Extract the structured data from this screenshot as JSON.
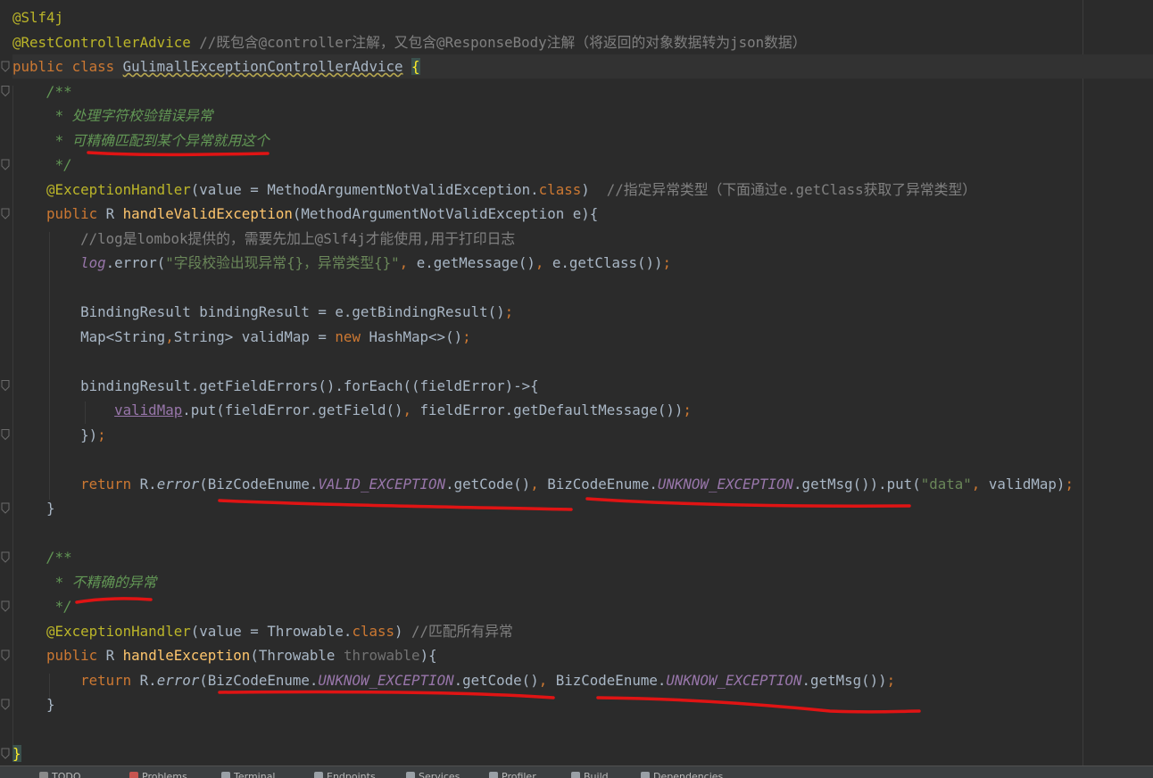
{
  "editor": {
    "lines": [
      [
        {
          "c": "ann",
          "t": "@Slf4j"
        }
      ],
      [
        {
          "c": "ann",
          "t": "@RestControllerAdvice"
        },
        {
          "c": "",
          "t": " "
        },
        {
          "c": "cmt",
          "t": "//既包含@controller注解，又包含@ResponseBody注解（将返回的对象数据转为json数据）"
        }
      ],
      [
        {
          "c": "kw",
          "t": "public class "
        },
        {
          "c": "ul-yellow",
          "t": "GulimallExceptionControllerAdvice"
        },
        {
          "c": "",
          "t": " "
        },
        {
          "c": "brace-match",
          "t": "{"
        }
      ],
      [
        {
          "c": "",
          "t": "    "
        },
        {
          "c": "doc",
          "t": "/**"
        }
      ],
      [
        {
          "c": "",
          "t": "     "
        },
        {
          "c": "doc",
          "t": "* 处理字符校验错误异常"
        }
      ],
      [
        {
          "c": "",
          "t": "     "
        },
        {
          "c": "doc",
          "t": "* 可精确匹配到某个异常就用这个"
        }
      ],
      [
        {
          "c": "",
          "t": "     "
        },
        {
          "c": "doc",
          "t": "*/"
        }
      ],
      [
        {
          "c": "",
          "t": "    "
        },
        {
          "c": "ann",
          "t": "@ExceptionHandler"
        },
        {
          "c": "",
          "t": "(value = MethodArgumentNotValidException."
        },
        {
          "c": "kw",
          "t": "class"
        },
        {
          "c": "",
          "t": ")  "
        },
        {
          "c": "cmt",
          "t": "//指定异常类型（下面通过e.getClass获取了异常类型）"
        }
      ],
      [
        {
          "c": "",
          "t": "    "
        },
        {
          "c": "kw",
          "t": "public "
        },
        {
          "c": "",
          "t": "R "
        },
        {
          "c": "meth",
          "t": "handleValidException"
        },
        {
          "c": "",
          "t": "(MethodArgumentNotValidException e){"
        }
      ],
      [
        {
          "c": "",
          "t": "        "
        },
        {
          "c": "cmt",
          "t": "//log是lombok提供的，需要先加上@Slf4j才能使用,用于打印日志"
        }
      ],
      [
        {
          "c": "",
          "t": "        "
        },
        {
          "c": "stat",
          "t": "log"
        },
        {
          "c": "",
          "t": ".error("
        },
        {
          "c": "str",
          "t": "\"字段校验出现异常{}，异常类型{}\""
        },
        {
          "c": "kw",
          "t": ", "
        },
        {
          "c": "",
          "t": "e.getMessage()"
        },
        {
          "c": "kw",
          "t": ", "
        },
        {
          "c": "",
          "t": "e.getClass())"
        },
        {
          "c": "kw",
          "t": ";"
        }
      ],
      [],
      [
        {
          "c": "",
          "t": "        BindingResult bindingResult = e.getBindingResult()"
        },
        {
          "c": "kw",
          "t": ";"
        }
      ],
      [
        {
          "c": "",
          "t": "        Map<String"
        },
        {
          "c": "kw",
          "t": ","
        },
        {
          "c": "",
          "t": "String> validMap = "
        },
        {
          "c": "kw",
          "t": "new "
        },
        {
          "c": "",
          "t": "HashMap<>()"
        },
        {
          "c": "kw",
          "t": ";"
        }
      ],
      [],
      [
        {
          "c": "",
          "t": "        bindingResult.getFieldErrors().forEach((fieldError)->{"
        }
      ],
      [
        {
          "c": "",
          "t": "            "
        },
        {
          "c": "inst ul-purple",
          "t": "validMap"
        },
        {
          "c": "",
          "t": ".put(fieldError.getField()"
        },
        {
          "c": "kw",
          "t": ", "
        },
        {
          "c": "",
          "t": "fieldError.getDefaultMessage())"
        },
        {
          "c": "kw",
          "t": ";"
        }
      ],
      [
        {
          "c": "",
          "t": "        })"
        },
        {
          "c": "kw",
          "t": ";"
        }
      ],
      [],
      [
        {
          "c": "",
          "t": "        "
        },
        {
          "c": "kw",
          "t": "return "
        },
        {
          "c": "",
          "t": "R."
        },
        {
          "c": "italic",
          "t": "error"
        },
        {
          "c": "",
          "t": "(BizCodeEnume."
        },
        {
          "c": "stat",
          "t": "VALID_EXCEPTION"
        },
        {
          "c": "",
          "t": ".getCode()"
        },
        {
          "c": "kw",
          "t": ", "
        },
        {
          "c": "",
          "t": "BizCodeEnume."
        },
        {
          "c": "stat",
          "t": "UNKNOW_EXCEPTION"
        },
        {
          "c": "",
          "t": ".getMsg()).put("
        },
        {
          "c": "str",
          "t": "\"data\""
        },
        {
          "c": "kw",
          "t": ", "
        },
        {
          "c": "",
          "t": "validMap)"
        },
        {
          "c": "kw",
          "t": ";"
        }
      ],
      [
        {
          "c": "",
          "t": "    }"
        }
      ],
      [],
      [
        {
          "c": "",
          "t": "    "
        },
        {
          "c": "doc",
          "t": "/**"
        }
      ],
      [
        {
          "c": "",
          "t": "     "
        },
        {
          "c": "doc",
          "t": "* 不精确的异常"
        }
      ],
      [
        {
          "c": "",
          "t": "     "
        },
        {
          "c": "doc",
          "t": "*/"
        }
      ],
      [
        {
          "c": "",
          "t": "    "
        },
        {
          "c": "ann",
          "t": "@ExceptionHandler"
        },
        {
          "c": "",
          "t": "(value = Throwable."
        },
        {
          "c": "kw",
          "t": "class"
        },
        {
          "c": "",
          "t": ") "
        },
        {
          "c": "cmt",
          "t": "//匹配所有异常"
        }
      ],
      [
        {
          "c": "",
          "t": "    "
        },
        {
          "c": "kw",
          "t": "public "
        },
        {
          "c": "",
          "t": "R "
        },
        {
          "c": "meth",
          "t": "handleException"
        },
        {
          "c": "",
          "t": "(Throwable "
        },
        {
          "c": "unused",
          "t": "throwable"
        },
        {
          "c": "",
          "t": "){"
        }
      ],
      [
        {
          "c": "",
          "t": "        "
        },
        {
          "c": "kw",
          "t": "return "
        },
        {
          "c": "",
          "t": "R."
        },
        {
          "c": "italic",
          "t": "error"
        },
        {
          "c": "",
          "t": "(BizCodeEnume."
        },
        {
          "c": "stat",
          "t": "UNKNOW_EXCEPTION"
        },
        {
          "c": "",
          "t": ".getCode()"
        },
        {
          "c": "kw",
          "t": ", "
        },
        {
          "c": "",
          "t": "BizCodeEnume."
        },
        {
          "c": "stat",
          "t": "UNKNOW_EXCEPTION"
        },
        {
          "c": "",
          "t": ".getMsg())"
        },
        {
          "c": "kw",
          "t": ";"
        }
      ],
      [
        {
          "c": "",
          "t": "    }"
        }
      ],
      [],
      [
        {
          "c": "brace-match",
          "t": "}"
        }
      ]
    ]
  },
  "status_bar": {
    "tabs": [
      {
        "icon": "todo-icon",
        "label": "TODO"
      },
      {
        "icon": "problems-icon",
        "label": "Problems"
      },
      {
        "icon": "terminal-icon",
        "label": "Terminal"
      },
      {
        "icon": "endpoints-icon",
        "label": "Endpoints"
      },
      {
        "icon": "services-icon",
        "label": "Services"
      },
      {
        "icon": "profiler-icon",
        "label": "Profiler"
      },
      {
        "icon": "build-icon",
        "label": "Build"
      },
      {
        "icon": "dependencies-icon",
        "label": "Dependencies"
      }
    ]
  }
}
